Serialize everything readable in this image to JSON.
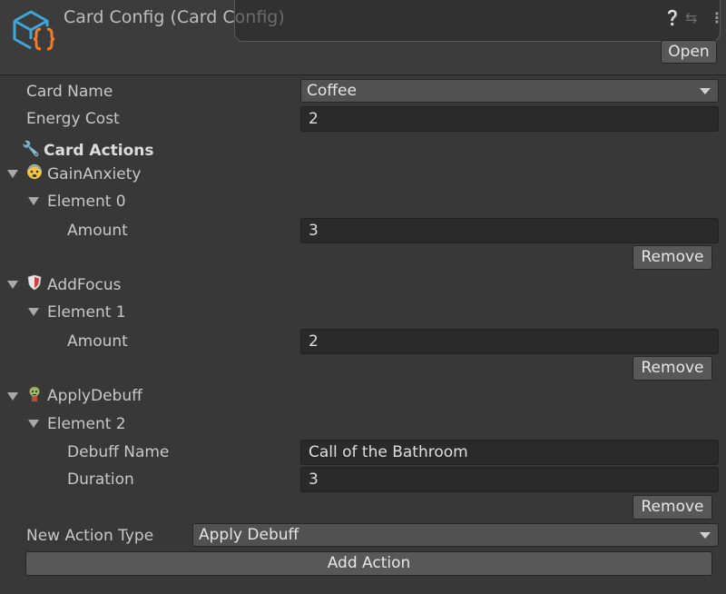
{
  "header": {
    "title": "Card Config (Card Config)",
    "open_label": "Open",
    "icons": [
      "card-config-script-icon",
      "help-icon",
      "preset-icon",
      "kebab-menu-icon"
    ]
  },
  "fields": {
    "card_name_label": "Card Name",
    "card_name_value": "Coffee",
    "energy_cost_label": "Energy Cost",
    "energy_cost_value": "2"
  },
  "card_actions": {
    "label": "Card Actions",
    "icon": "wrench-icon",
    "actions": [
      {
        "type": "GainAnxiety",
        "icon": "anxious-face-icon",
        "element": "Element 0",
        "props": [
          {
            "label": "Amount",
            "value": "3"
          }
        ],
        "remove_label": "Remove"
      },
      {
        "type": "AddFocus",
        "icon": "shield-icon",
        "element": "Element 1",
        "props": [
          {
            "label": "Amount",
            "value": "2"
          }
        ],
        "remove_label": "Remove"
      },
      {
        "type": "ApplyDebuff",
        "icon": "zombie-icon",
        "element": "Element 2",
        "props": [
          {
            "label": "Debuff Name",
            "value": "Call of the Bathroom"
          },
          {
            "label": "Duration",
            "value": "3"
          }
        ],
        "remove_label": "Remove"
      }
    ]
  },
  "footer": {
    "new_action_type_label": "New Action Type",
    "new_action_type_value": "Apply Debuff",
    "add_action_label": "Add Action"
  },
  "colors": {
    "background": "#383838",
    "field": "#2a2a2a",
    "button": "#585858",
    "logo_blue": "#3ea6d8",
    "logo_orange": "#f07a2c"
  }
}
